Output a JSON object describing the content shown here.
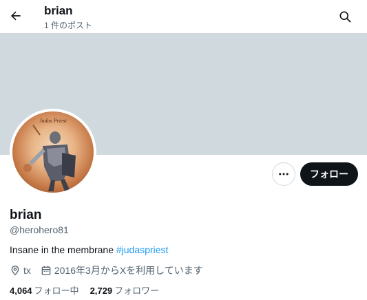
{
  "header": {
    "title": "brian",
    "post_count": "1 件のポスト"
  },
  "profile": {
    "display_name": "brian",
    "handle": "@herohero81",
    "bio_text": "Insane in the membrane ",
    "bio_hashtag": "#judaspriest",
    "location": "tx",
    "joined": "2016年3月からXを利用しています",
    "avatar_caption": "Judas Priest"
  },
  "actions": {
    "follow_label": "フォロー"
  },
  "stats": {
    "following_count": "4,064",
    "following_label": "フォロー中",
    "followers_count": "2,729",
    "followers_label": "フォロワー"
  },
  "colors": {
    "banner": "#cfd9de",
    "accent": "#1d9bf0",
    "button_dark": "#0f1419",
    "muted_text": "#536471"
  },
  "icons": {
    "back": "arrow-left-icon",
    "search": "search-icon",
    "more": "more-dots-icon",
    "location": "location-pin-icon",
    "calendar": "calendar-icon"
  }
}
